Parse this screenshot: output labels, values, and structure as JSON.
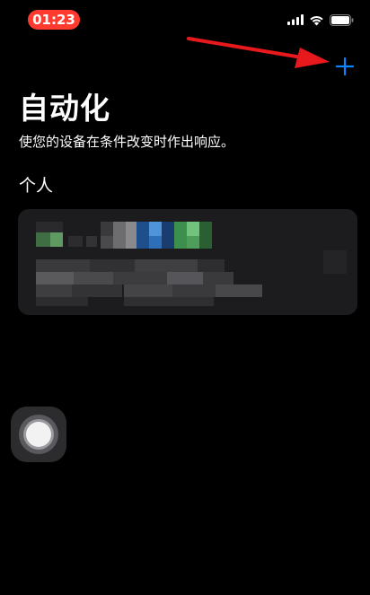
{
  "status_bar": {
    "time": "01:23",
    "time_pill_color": "#ff3b30",
    "icons": [
      "signal-icon",
      "wifi-icon",
      "battery-icon"
    ]
  },
  "toolbar": {
    "add_icon": "plus-icon",
    "add_color": "#0a84ff"
  },
  "annotation": {
    "icon": "arrow-icon",
    "color": "#e8191c"
  },
  "header": {
    "title": "自动化",
    "subtitle": "使您的设备在条件改变时作出响应。"
  },
  "section": {
    "label": "个人"
  },
  "automation_card": {
    "content": "pixelated (obscured)"
  },
  "assistive_touch": {
    "icon": "assistive-touch-icon"
  }
}
